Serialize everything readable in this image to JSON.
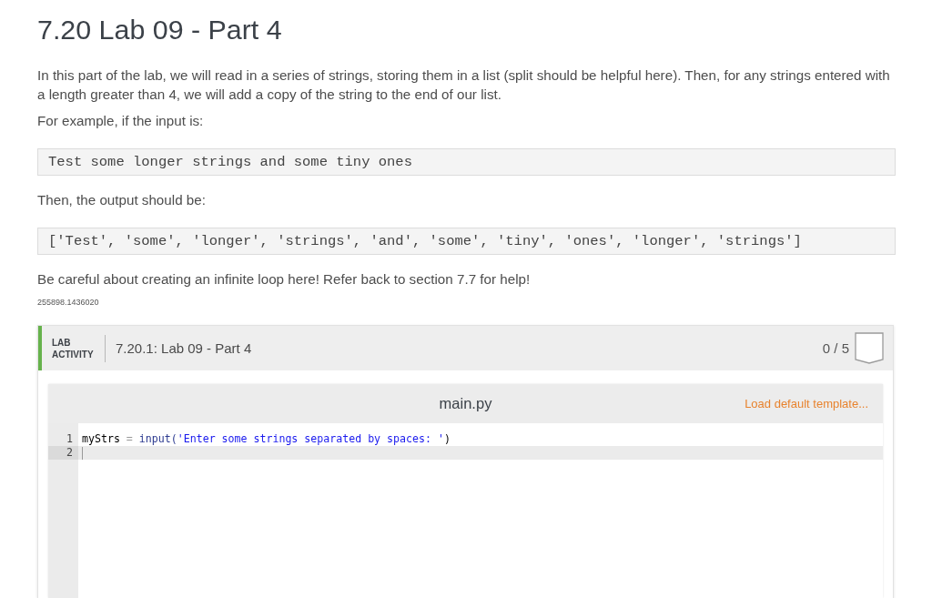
{
  "page": {
    "title": "7.20 Lab 09 - Part 4"
  },
  "content": [
    {
      "kind": "paragraph",
      "text": "In this part of the lab, we will read in a series of strings, storing them in a list (split should be helpful here). Then, for any strings entered with a length greater than 4, we will add a copy of the string to the end of our list."
    },
    {
      "kind": "paragraph",
      "text": "For example, if the input is:"
    },
    {
      "kind": "code",
      "text": "Test some longer strings and some tiny ones"
    },
    {
      "kind": "paragraph",
      "text": "Then, the output should be:"
    },
    {
      "kind": "code",
      "text": "['Test', 'some', 'longer', 'strings', 'and', 'some', 'tiny', 'ones', 'longer', 'strings']"
    },
    {
      "kind": "paragraph",
      "text": "Be careful about creating an infinite loop here! Refer back to section 7.7 for help!"
    },
    {
      "kind": "note",
      "text": "255898.1436020"
    }
  ],
  "lab_activity": {
    "label": "LAB ACTIVITY",
    "title": "7.20.1: Lab 09 - Part 4",
    "score": "0 / 5",
    "editor": {
      "filename": "main.py",
      "action": "Load default template...",
      "lines": [
        {
          "number": "1",
          "active": false,
          "tokens": [
            {
              "kind": "variable",
              "text": "myStrs"
            },
            {
              "kind": "operator",
              "text": " = "
            },
            {
              "kind": "builtin",
              "text": "input("
            },
            {
              "kind": "string",
              "text": "'Enter some strings separated by spaces: '"
            },
            {
              "kind": "punct",
              "text": ")"
            }
          ]
        },
        {
          "number": "2",
          "active": true
        }
      ]
    }
  }
}
